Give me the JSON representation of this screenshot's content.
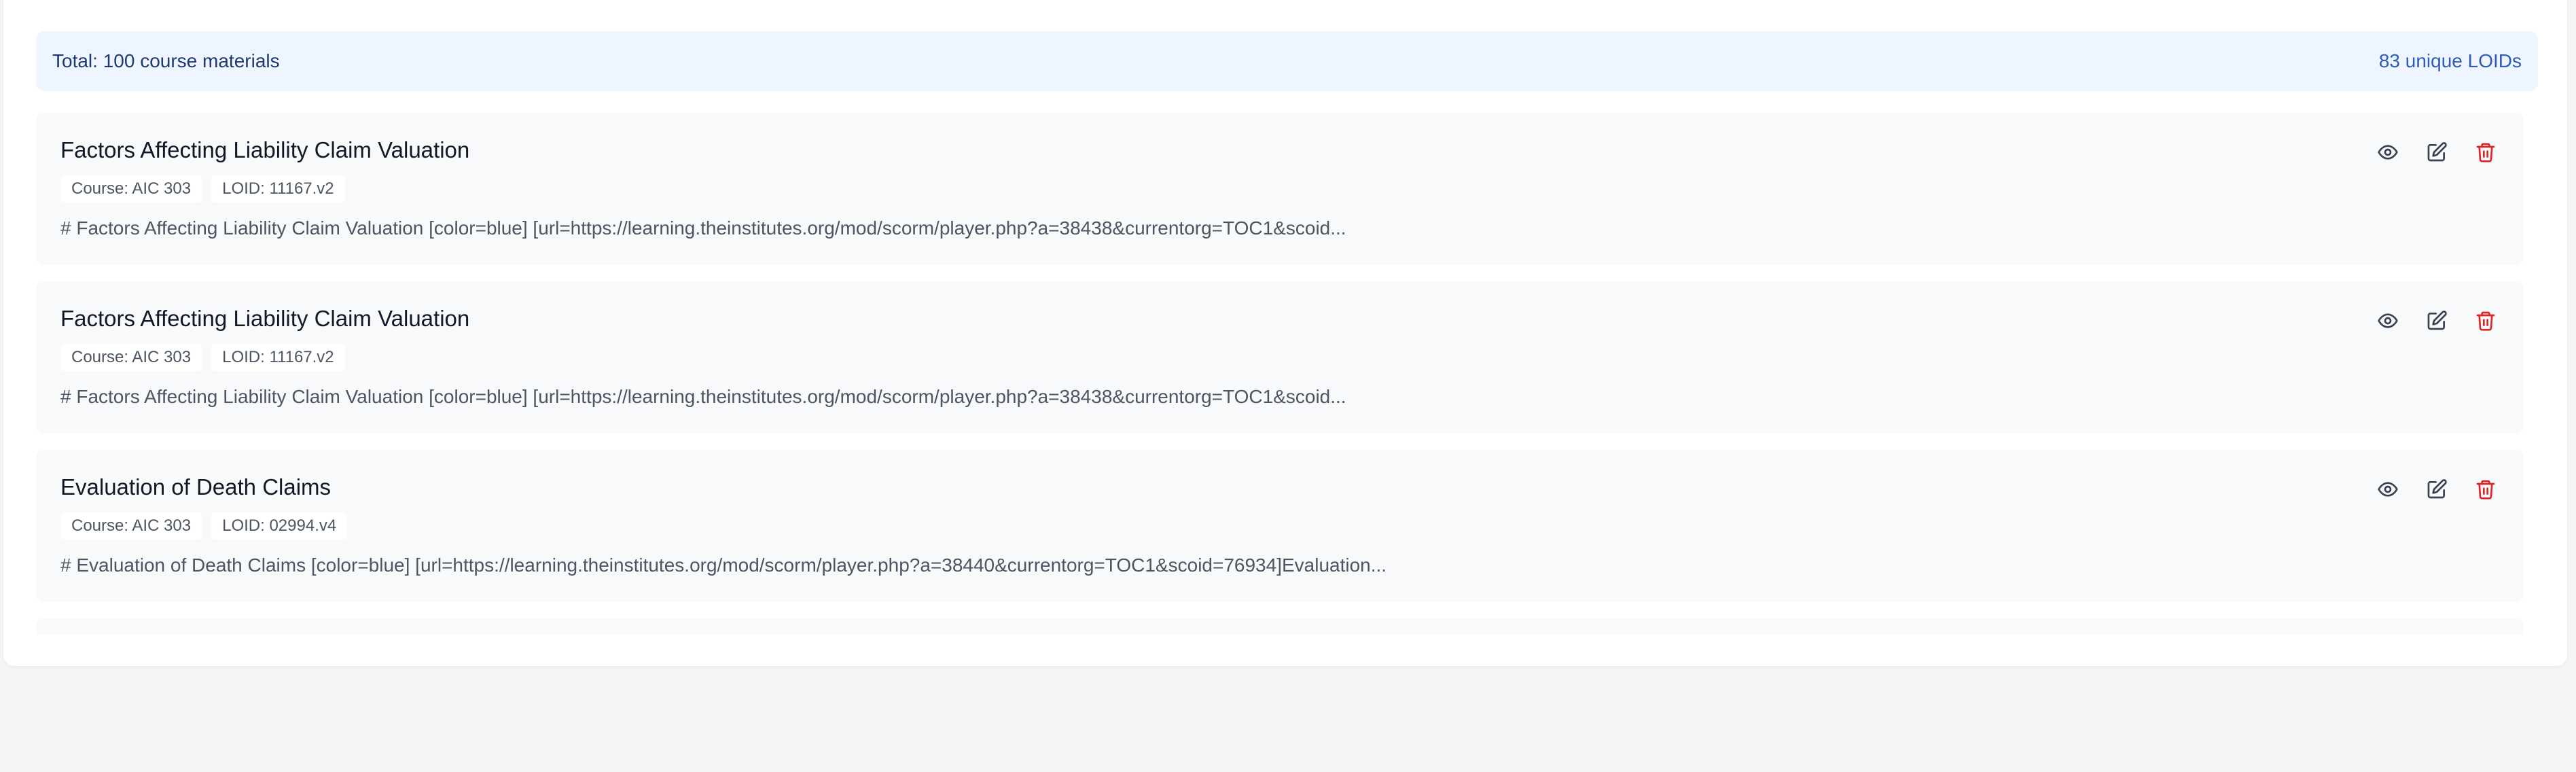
{
  "summary": {
    "total": "Total: 100 course materials",
    "unique": "83 unique LOIDs"
  },
  "colors": {
    "summary_bg": "#eef5fe",
    "card_bg": "#f8f9fb",
    "delete_icon": "#dc2626",
    "icon": "#374151"
  },
  "materials": [
    {
      "title": "Factors Affecting Liability Claim Valuation",
      "course": "Course: AIC 303",
      "loid": "LOID: 11167.v2",
      "description": "# Factors Affecting Liability Claim Valuation [color=blue] [url=https://learning.theinstitutes.org/mod/scorm/player.php?a=38438&currentorg=TOC1&scoid..."
    },
    {
      "title": "Factors Affecting Liability Claim Valuation",
      "course": "Course: AIC 303",
      "loid": "LOID: 11167.v2",
      "description": "# Factors Affecting Liability Claim Valuation [color=blue] [url=https://learning.theinstitutes.org/mod/scorm/player.php?a=38438&currentorg=TOC1&scoid..."
    },
    {
      "title": "Evaluation of Death Claims",
      "course": "Course: AIC 303",
      "loid": "LOID: 02994.v4",
      "description": "# Evaluation of Death Claims [color=blue] [url=https://learning.theinstitutes.org/mod/scorm/player.php?a=38440&currentorg=TOC1&scoid=76934]Evaluation..."
    }
  ],
  "icons": {
    "view": "eye-icon",
    "edit": "edit-icon",
    "delete": "trash-icon"
  }
}
